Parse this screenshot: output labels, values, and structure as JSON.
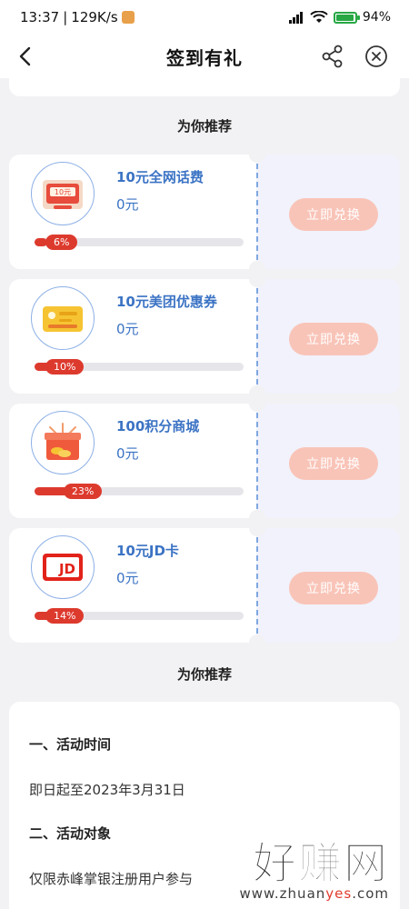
{
  "status_bar": {
    "time": "13:37",
    "speed": "129K/s",
    "battery": "94%"
  },
  "nav": {
    "title": "签到有礼"
  },
  "recommend_title_top": "为你推荐",
  "rewards": [
    {
      "name": "10元全网话费",
      "price": "0元",
      "progress": 6,
      "progress_label": "6%",
      "button": "立即兑换"
    },
    {
      "name": "10元美团优惠券",
      "price": "0元",
      "progress": 10,
      "progress_label": "10%",
      "button": "立即兑换"
    },
    {
      "name": "100积分商城",
      "price": "0元",
      "progress": 23,
      "progress_label": "23%",
      "button": "立即兑换"
    },
    {
      "name": "10元JD卡",
      "price": "0元",
      "progress": 14,
      "progress_label": "14%",
      "button": "立即兑换"
    }
  ],
  "recommend_title_bottom": "为你推荐",
  "rules": {
    "heading_1": "一、活动时间",
    "text_1": "即日起至2023年3月31日",
    "heading_2": "二、活动对象",
    "text_2": "仅限赤峰掌银注册用户参与"
  },
  "watermark": {
    "brand": "好赚网",
    "domain_prefix": "www.zhuan",
    "domain_accent": "yes",
    "domain_suffix": ".com"
  },
  "colors": {
    "accent_blue": "#3b73c4",
    "progress_red": "#dd3a2e",
    "button_pink": "#f9c4b8"
  }
}
